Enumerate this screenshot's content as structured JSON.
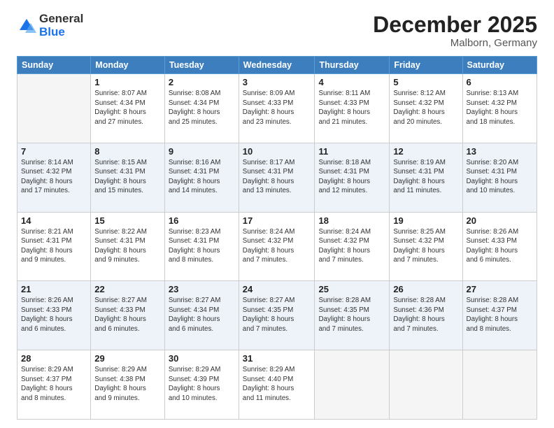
{
  "logo": {
    "general": "General",
    "blue": "Blue"
  },
  "header": {
    "title": "December 2025",
    "subtitle": "Malborn, Germany"
  },
  "days_of_week": [
    "Sunday",
    "Monday",
    "Tuesday",
    "Wednesday",
    "Thursday",
    "Friday",
    "Saturday"
  ],
  "weeks": [
    {
      "days": [
        {
          "num": "",
          "info": ""
        },
        {
          "num": "1",
          "info": "Sunrise: 8:07 AM\nSunset: 4:34 PM\nDaylight: 8 hours\nand 27 minutes."
        },
        {
          "num": "2",
          "info": "Sunrise: 8:08 AM\nSunset: 4:34 PM\nDaylight: 8 hours\nand 25 minutes."
        },
        {
          "num": "3",
          "info": "Sunrise: 8:09 AM\nSunset: 4:33 PM\nDaylight: 8 hours\nand 23 minutes."
        },
        {
          "num": "4",
          "info": "Sunrise: 8:11 AM\nSunset: 4:33 PM\nDaylight: 8 hours\nand 21 minutes."
        },
        {
          "num": "5",
          "info": "Sunrise: 8:12 AM\nSunset: 4:32 PM\nDaylight: 8 hours\nand 20 minutes."
        },
        {
          "num": "6",
          "info": "Sunrise: 8:13 AM\nSunset: 4:32 PM\nDaylight: 8 hours\nand 18 minutes."
        }
      ]
    },
    {
      "days": [
        {
          "num": "7",
          "info": "Sunrise: 8:14 AM\nSunset: 4:32 PM\nDaylight: 8 hours\nand 17 minutes."
        },
        {
          "num": "8",
          "info": "Sunrise: 8:15 AM\nSunset: 4:31 PM\nDaylight: 8 hours\nand 15 minutes."
        },
        {
          "num": "9",
          "info": "Sunrise: 8:16 AM\nSunset: 4:31 PM\nDaylight: 8 hours\nand 14 minutes."
        },
        {
          "num": "10",
          "info": "Sunrise: 8:17 AM\nSunset: 4:31 PM\nDaylight: 8 hours\nand 13 minutes."
        },
        {
          "num": "11",
          "info": "Sunrise: 8:18 AM\nSunset: 4:31 PM\nDaylight: 8 hours\nand 12 minutes."
        },
        {
          "num": "12",
          "info": "Sunrise: 8:19 AM\nSunset: 4:31 PM\nDaylight: 8 hours\nand 11 minutes."
        },
        {
          "num": "13",
          "info": "Sunrise: 8:20 AM\nSunset: 4:31 PM\nDaylight: 8 hours\nand 10 minutes."
        }
      ]
    },
    {
      "days": [
        {
          "num": "14",
          "info": "Sunrise: 8:21 AM\nSunset: 4:31 PM\nDaylight: 8 hours\nand 9 minutes."
        },
        {
          "num": "15",
          "info": "Sunrise: 8:22 AM\nSunset: 4:31 PM\nDaylight: 8 hours\nand 9 minutes."
        },
        {
          "num": "16",
          "info": "Sunrise: 8:23 AM\nSunset: 4:31 PM\nDaylight: 8 hours\nand 8 minutes."
        },
        {
          "num": "17",
          "info": "Sunrise: 8:24 AM\nSunset: 4:32 PM\nDaylight: 8 hours\nand 7 minutes."
        },
        {
          "num": "18",
          "info": "Sunrise: 8:24 AM\nSunset: 4:32 PM\nDaylight: 8 hours\nand 7 minutes."
        },
        {
          "num": "19",
          "info": "Sunrise: 8:25 AM\nSunset: 4:32 PM\nDaylight: 8 hours\nand 7 minutes."
        },
        {
          "num": "20",
          "info": "Sunrise: 8:26 AM\nSunset: 4:33 PM\nDaylight: 8 hours\nand 6 minutes."
        }
      ]
    },
    {
      "days": [
        {
          "num": "21",
          "info": "Sunrise: 8:26 AM\nSunset: 4:33 PM\nDaylight: 8 hours\nand 6 minutes."
        },
        {
          "num": "22",
          "info": "Sunrise: 8:27 AM\nSunset: 4:33 PM\nDaylight: 8 hours\nand 6 minutes."
        },
        {
          "num": "23",
          "info": "Sunrise: 8:27 AM\nSunset: 4:34 PM\nDaylight: 8 hours\nand 6 minutes."
        },
        {
          "num": "24",
          "info": "Sunrise: 8:27 AM\nSunset: 4:35 PM\nDaylight: 8 hours\nand 7 minutes."
        },
        {
          "num": "25",
          "info": "Sunrise: 8:28 AM\nSunset: 4:35 PM\nDaylight: 8 hours\nand 7 minutes."
        },
        {
          "num": "26",
          "info": "Sunrise: 8:28 AM\nSunset: 4:36 PM\nDaylight: 8 hours\nand 7 minutes."
        },
        {
          "num": "27",
          "info": "Sunrise: 8:28 AM\nSunset: 4:37 PM\nDaylight: 8 hours\nand 8 minutes."
        }
      ]
    },
    {
      "days": [
        {
          "num": "28",
          "info": "Sunrise: 8:29 AM\nSunset: 4:37 PM\nDaylight: 8 hours\nand 8 minutes."
        },
        {
          "num": "29",
          "info": "Sunrise: 8:29 AM\nSunset: 4:38 PM\nDaylight: 8 hours\nand 9 minutes."
        },
        {
          "num": "30",
          "info": "Sunrise: 8:29 AM\nSunset: 4:39 PM\nDaylight: 8 hours\nand 10 minutes."
        },
        {
          "num": "31",
          "info": "Sunrise: 8:29 AM\nSunset: 4:40 PM\nDaylight: 8 hours\nand 11 minutes."
        },
        {
          "num": "",
          "info": ""
        },
        {
          "num": "",
          "info": ""
        },
        {
          "num": "",
          "info": ""
        }
      ]
    }
  ]
}
